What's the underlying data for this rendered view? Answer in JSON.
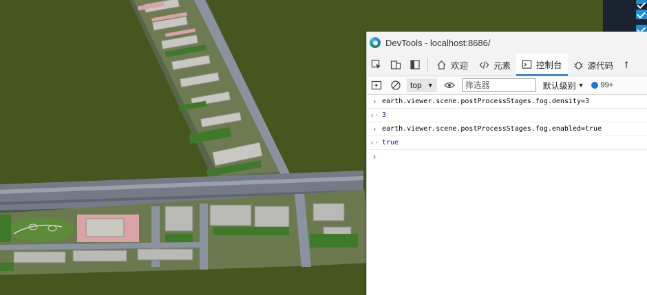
{
  "devtools": {
    "title": "DevTools - localhost:8686/",
    "tabs": [
      {
        "label": "欢迎",
        "icon": "home-icon"
      },
      {
        "label": "元素",
        "icon": "code-icon"
      },
      {
        "label": "控制台",
        "icon": "console-icon",
        "active": true
      },
      {
        "label": "源代码",
        "icon": "bug-icon"
      }
    ],
    "toolbar": {
      "context": "top",
      "filter_placeholder": "筛选器",
      "levels": "默认级别",
      "issues_count": "99+"
    },
    "console": [
      {
        "type": "input",
        "text": "earth.viewer.scene.postProcessStages.fog.density=3"
      },
      {
        "type": "output",
        "text": "3",
        "kind": "number"
      },
      {
        "type": "input",
        "text": "earth.viewer.scene.postProcessStages.fog.enabled=true"
      },
      {
        "type": "output",
        "text": "true",
        "kind": "keyword"
      }
    ],
    "accent_color": "#0f6cbd"
  },
  "scene": {
    "background_color": "#46561f",
    "checkbox_color": "#1e8fd6"
  }
}
